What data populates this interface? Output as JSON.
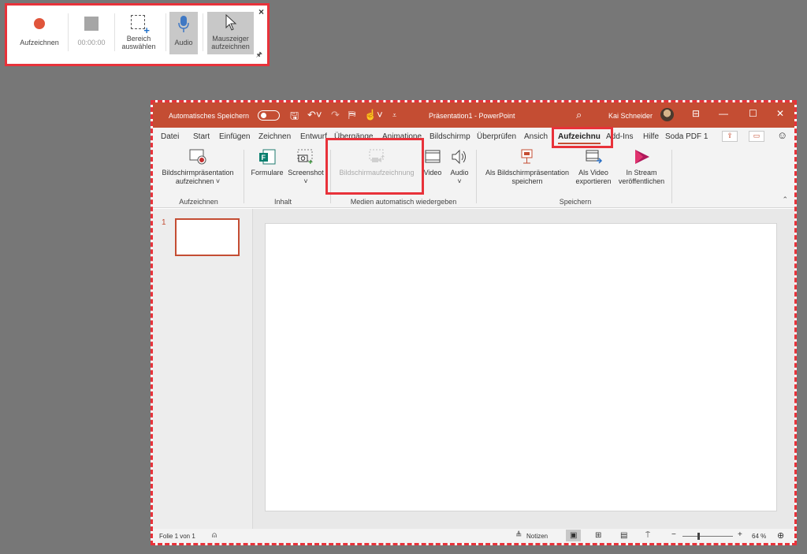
{
  "recorder": {
    "record_label": "Aufzeichnen",
    "time": "00:00:00",
    "area_label": "Bereich auswählen",
    "audio_label": "Audio",
    "pointer_label": "Mauszeiger aufzeichnen",
    "close": "×",
    "pin": "🖈"
  },
  "titlebar": {
    "autosave": "Automatisches Speichern",
    "title": "Präsentation1  -  PowerPoint",
    "user": "Kai Schneider",
    "accent": "#c44d33"
  },
  "tabs": [
    "Datei",
    "Start",
    "Einfügen",
    "Zeichnen",
    "Entwurf",
    "Übergänge",
    "Animatione",
    "Bildschirmp",
    "Überprüfen",
    "Ansich",
    "Aufzeichnu",
    "Add-Ins",
    "Hilfe",
    "Soda PDF 1"
  ],
  "ribbon": {
    "screen_presentation_record": "Bildschirmpräsentation aufzeichnen ˅",
    "group_record": "Aufzeichnen",
    "forms": "Formulare",
    "screenshot": "Screenshot ˅",
    "group_content": "Inhalt",
    "screen_recording": "Bildschirmaufzeichnung",
    "video": "Video",
    "audio": "Audio ˅",
    "group_media": "Medien automatisch wiedergeben",
    "save_as_show": "Als Bildschirmpräsentation speichern",
    "export_video": "Als Video exportieren",
    "stream_publish": "In Stream veröffentlichen",
    "group_save": "Speichern"
  },
  "slides": {
    "number": "1"
  },
  "status": {
    "slide_info": "Folie 1 von 1",
    "notes": "Notizen",
    "zoom": "64 %",
    "zoom_level": 0.64
  }
}
